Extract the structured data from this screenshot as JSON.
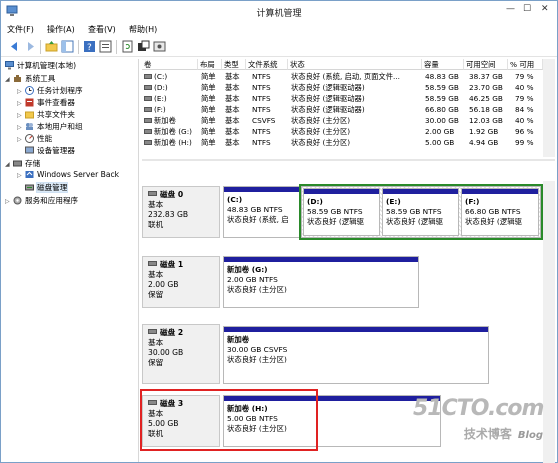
{
  "window": {
    "title": "计算机管理"
  },
  "menu": [
    "文件(F)",
    "操作(A)",
    "查看(V)",
    "帮助(H)"
  ],
  "toolbar": [
    "back-icon",
    "forward-icon",
    "up-folder-icon",
    "show-tree-icon",
    "help-icon",
    "properties-icon",
    "refresh-icon",
    "export-icon",
    "settings-icon"
  ],
  "tree": {
    "root": "计算机管理(本地)",
    "items": [
      {
        "label": "系统工具",
        "level": 1,
        "arrow": "◢"
      },
      {
        "label": "任务计划程序",
        "level": 2,
        "arrow": "▷"
      },
      {
        "label": "事件查看器",
        "level": 2,
        "arrow": "▷"
      },
      {
        "label": "共享文件夹",
        "level": 2,
        "arrow": "▷"
      },
      {
        "label": "本地用户和组",
        "level": 2,
        "arrow": "▷"
      },
      {
        "label": "性能",
        "level": 2,
        "arrow": "▷"
      },
      {
        "label": "设备管理器",
        "level": 2,
        "arrow": ""
      },
      {
        "label": "存储",
        "level": 1,
        "arrow": "◢"
      },
      {
        "label": "Windows Server Back",
        "level": 2,
        "arrow": "▷"
      },
      {
        "label": "磁盘管理",
        "level": 2,
        "arrow": "",
        "selected": true
      },
      {
        "label": "服务和应用程序",
        "level": 1,
        "arrow": "▷"
      }
    ]
  },
  "volumes": {
    "headers": [
      "卷",
      "布局",
      "类型",
      "文件系统",
      "状态",
      "容量",
      "可用空间",
      "% 可用"
    ],
    "rows": [
      [
        "(C:)",
        "简单",
        "基本",
        "NTFS",
        "状态良好 (系统, 启动, 页面文件...",
        "48.83 GB",
        "38.37 GB",
        "79 %"
      ],
      [
        "(D:)",
        "简单",
        "基本",
        "NTFS",
        "状态良好 (逻辑驱动器)",
        "58.59 GB",
        "23.70 GB",
        "40 %"
      ],
      [
        "(E:)",
        "简单",
        "基本",
        "NTFS",
        "状态良好 (逻辑驱动器)",
        "58.59 GB",
        "46.25 GB",
        "79 %"
      ],
      [
        "(F:)",
        "简单",
        "基本",
        "NTFS",
        "状态良好 (逻辑驱动器)",
        "66.80 GB",
        "56.18 GB",
        "84 %"
      ],
      [
        "新加卷",
        "简单",
        "基本",
        "CSVFS",
        "状态良好 (主分区)",
        "30.00 GB",
        "12.03 GB",
        "40 %"
      ],
      [
        "新加卷 (G:)",
        "简单",
        "基本",
        "NTFS",
        "状态良好 (主分区)",
        "2.00 GB",
        "1.92 GB",
        "96 %"
      ],
      [
        "新加卷 (H:)",
        "简单",
        "基本",
        "NTFS",
        "状态良好 (主分区)",
        "5.00 GB",
        "4.94 GB",
        "99 %"
      ]
    ]
  },
  "disks": [
    {
      "name": "磁盘 0",
      "type": "基本",
      "size": "232.83 GB",
      "status": "联机",
      "partitions": [
        {
          "title": "(C:)",
          "line2": "48.83 GB NTFS",
          "line3": "状态良好 (系统, 启"
        },
        {
          "title": "(D:)",
          "line2": "58.59 GB NTFS",
          "line3": "状态良好 (逻辑驱"
        },
        {
          "title": "(E:)",
          "line2": "58.59 GB NTFS",
          "line3": "状态良好 (逻辑驱"
        },
        {
          "title": "(F:)",
          "line2": "66.80 GB NTFS",
          "line3": "状态良好 (逻辑驱"
        }
      ]
    },
    {
      "name": "磁盘 1",
      "type": "基本",
      "size": "2.00 GB",
      "status": "保留",
      "partitions": [
        {
          "title": "新加卷 (G:)",
          "line2": "2.00 GB NTFS",
          "line3": "状态良好 (主分区)"
        }
      ]
    },
    {
      "name": "磁盘 2",
      "type": "基本",
      "size": "30.00 GB",
      "status": "保留",
      "partitions": [
        {
          "title": "新加卷",
          "line2": "30.00 GB CSVFS",
          "line3": "状态良好 (主分区)"
        }
      ]
    },
    {
      "name": "磁盘 3",
      "type": "基本",
      "size": "5.00 GB",
      "status": "联机",
      "partitions": [
        {
          "title": "新加卷 (H:)",
          "line2": "5.00 GB NTFS",
          "line3": "状态良好 (主分区)"
        }
      ]
    }
  ],
  "watermark": {
    "big": "51CTO.com",
    "small": "技术博客",
    "blog": "Blog"
  },
  "colors": {
    "partition_bar": "#1f1f9e",
    "highlight_green": "#2a8a2a",
    "highlight_red": "#e02222"
  }
}
